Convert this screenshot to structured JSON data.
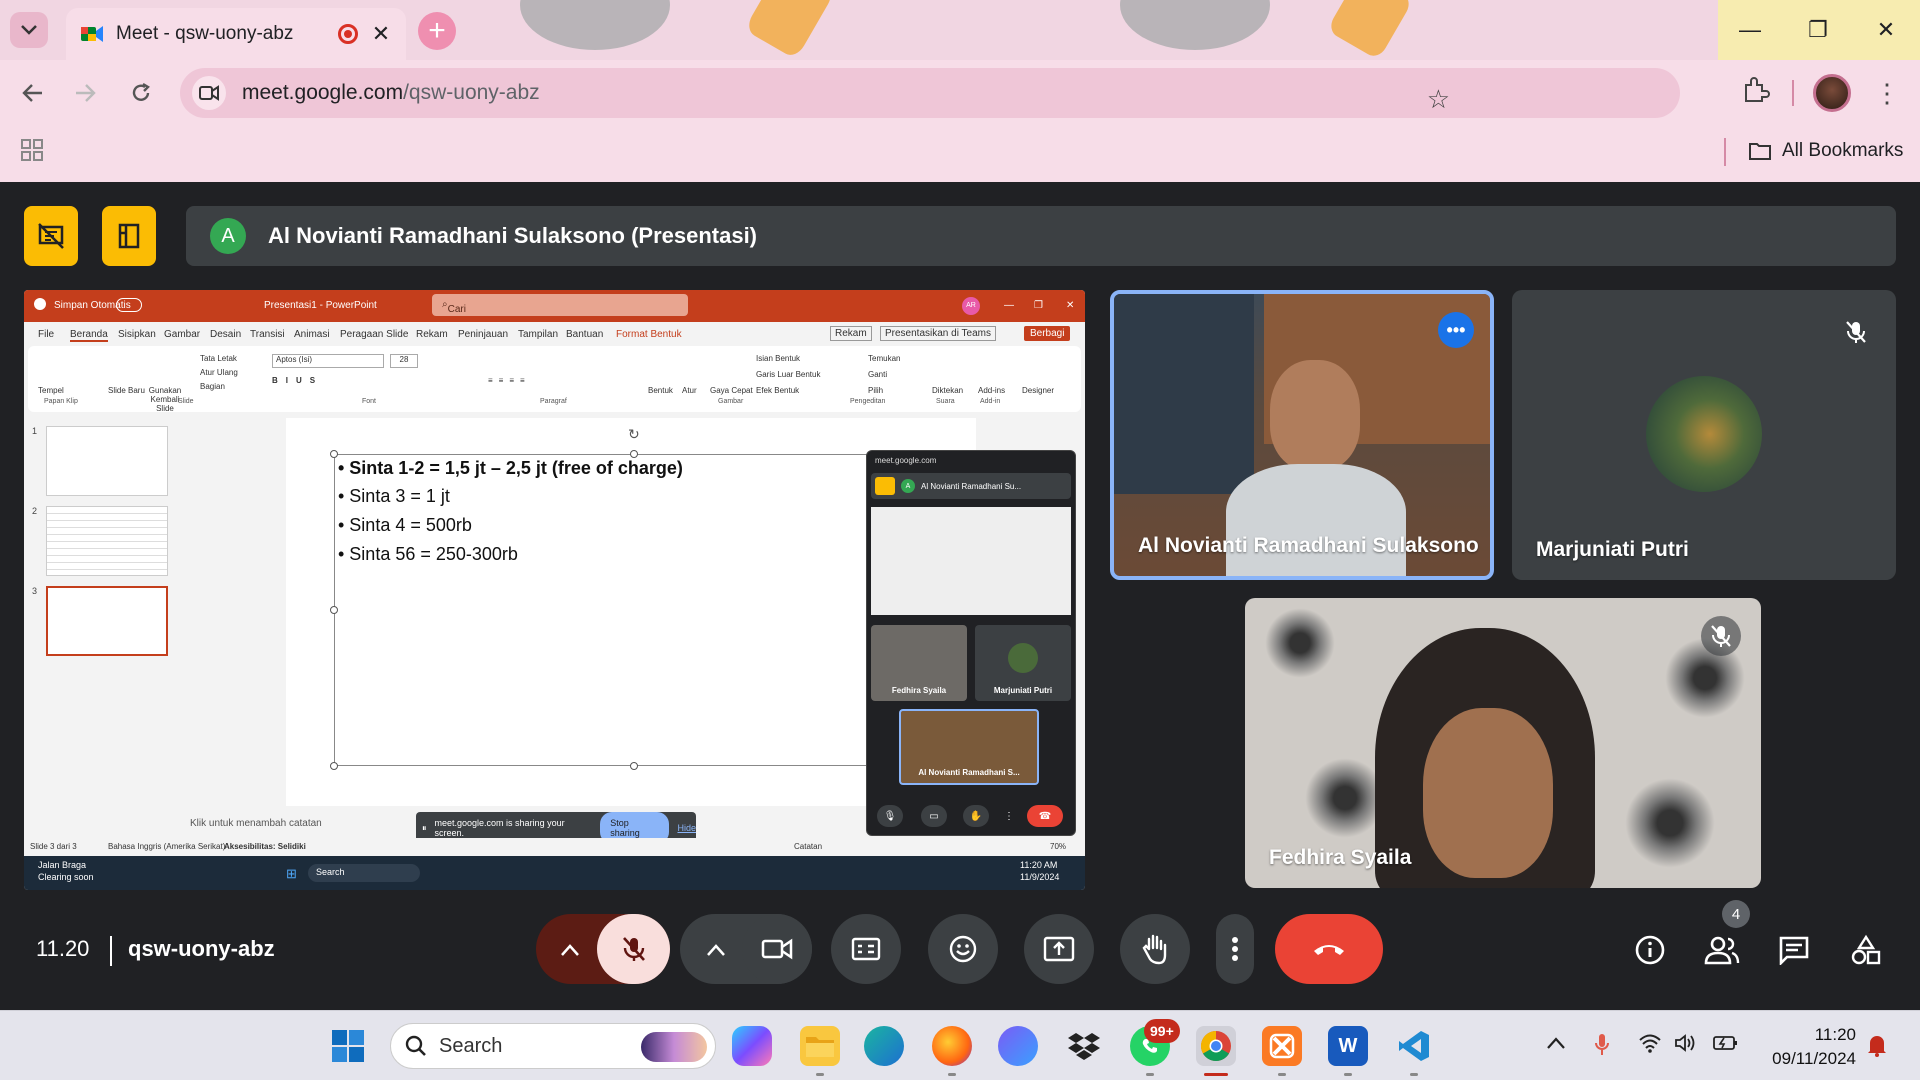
{
  "browser": {
    "tab_title": "Meet - qsw-uony-abz",
    "tab_close": "✕",
    "new_tab": "+",
    "url_host": "meet.google.com",
    "url_path": "/qsw-uony-abz",
    "all_bookmarks": "All Bookmarks",
    "window_controls": [
      "—",
      "❐",
      "✕"
    ]
  },
  "meet": {
    "presenter_initial": "A",
    "presenter_label": "Al Novianti Ramadhani Sulaksono (Presentasi)",
    "time": "11.20",
    "code": "qsw-uony-abz",
    "people_count": "4",
    "participants": [
      {
        "name": "Al Novianti Ramadhani Sulaksono",
        "muted": false,
        "active": true
      },
      {
        "name": "Marjuniati Putri",
        "muted": true
      },
      {
        "name": "Fedhira Syaila",
        "muted": true
      }
    ]
  },
  "shared_screen": {
    "ppt": {
      "autosave": "Simpan Otomatis",
      "title": "Presentasi1 - PowerPoint",
      "search": "Cari",
      "user_initials": "AR",
      "menu": [
        "File",
        "Beranda",
        "Sisipkan",
        "Gambar",
        "Desain",
        "Transisi",
        "Animasi",
        "Peragaan Slide",
        "Rekam",
        "Peninjauan",
        "Tampilan",
        "Bantuan",
        "Format Bentuk"
      ],
      "menu_right": [
        "Rekam",
        "Presentasikan di Teams",
        "Berbagi"
      ],
      "ribbon_groups": [
        "Papan Klip",
        "Slide",
        "Font",
        "Paragraf",
        "Gambar",
        "Pengeditan",
        "Suara",
        "Add-in"
      ],
      "ribbon_items": [
        "Tempel",
        "Slide Baru",
        "Gunakan Kembali Slide",
        "Tata Letak",
        "Atur Ulang",
        "Bagian",
        "Aptos (Isi)",
        "28",
        "Bentuk",
        "Atur",
        "Gaya Cepat",
        "Isian Bentuk",
        "Garis Luar Bentuk",
        "Efek Bentuk",
        "Temukan",
        "Ganti",
        "Pilih",
        "Diktekan",
        "Add-ins",
        "Designer"
      ],
      "slide_numbers": [
        "1",
        "2",
        "3"
      ],
      "bullets": [
        "• Sinta 1-2 = 1,5 jt – 2,5 jt (free of charge)",
        "• Sinta 3 = 1 jt",
        "• Sinta 4 = 500rb",
        "• Sinta 56 = 250-300rb"
      ],
      "notes_placeholder": "Klik untuk menambah catatan",
      "status_slide": "Slide 3 dari 3",
      "status_lang": "Bahasa Inggris (Amerika Serikat)",
      "status_access": "Aksesibilitas: Selidiki",
      "status_notes": "Catatan",
      "zoom": "70%"
    },
    "share_bar": {
      "text": "meet.google.com is sharing your screen.",
      "stop": "Stop sharing",
      "hide": "Hide"
    },
    "mini_meet": {
      "url": "meet.google.com",
      "presenter": "Al Novianti Ramadhani Su...",
      "tiles": [
        "Fedhira Syaila",
        "Marjuniati Putri",
        "Al Novianti Ramadhani S..."
      ]
    },
    "inner_taskbar": {
      "traffic_title": "Jalan Braga",
      "traffic_sub": "Clearing soon",
      "search": "Search",
      "time": "11:20 AM",
      "date": "11/9/2024"
    }
  },
  "taskbar": {
    "search_placeholder": "Search",
    "whatsapp_badge": "99+",
    "time": "11:20",
    "date": "09/11/2024"
  },
  "colors": {
    "meet_bg": "#202124",
    "tile_bg": "#3c4043",
    "present_yellow": "#fbbc04",
    "end_call_red": "#ea4335",
    "mic_off_pink": "#f9dedc",
    "ppt_orange": "#c43e1c",
    "chrome_pink": "#f7dde8"
  }
}
